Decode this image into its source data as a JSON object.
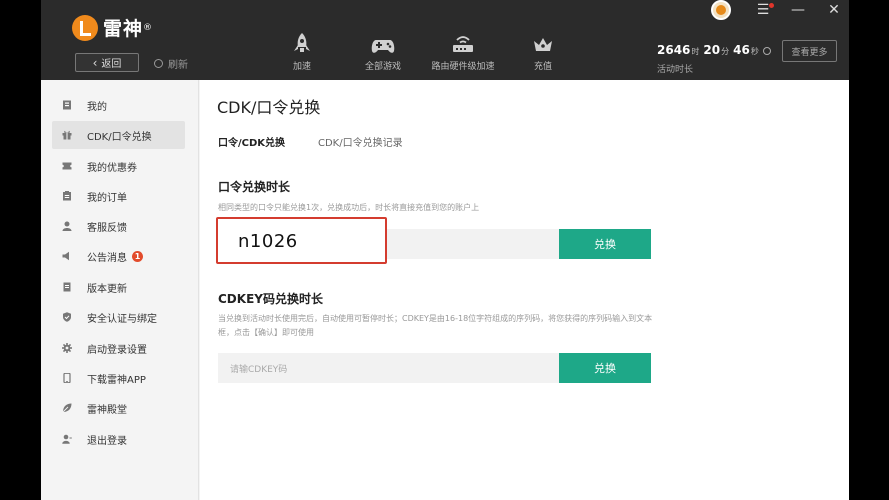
{
  "app": {
    "name": "雷神",
    "trademark": "®"
  },
  "topbar": {
    "back_label": "返回",
    "refresh_label": "刷新",
    "nav": [
      {
        "label": "加速",
        "icon": "rocket-icon"
      },
      {
        "label": "全部游戏",
        "icon": "gamepad-icon"
      },
      {
        "label": "路由硬件级加速",
        "icon": "router-icon"
      },
      {
        "label": "充值",
        "icon": "crown-icon"
      }
    ],
    "time": {
      "hours": "2646",
      "hours_unit": "时",
      "minutes": "20",
      "minutes_unit": "分",
      "seconds": "46",
      "seconds_unit": "秒",
      "label": "活动时长"
    },
    "view_more": "查看更多",
    "controls": {
      "menu": "☰",
      "minimize": "—",
      "close": "✕"
    }
  },
  "sidebar": {
    "items": [
      {
        "label": "我的",
        "icon": "user-card-icon"
      },
      {
        "label": "CDK/口令兑换",
        "icon": "gift-icon",
        "active": true
      },
      {
        "label": "我的优惠券",
        "icon": "coupon-icon"
      },
      {
        "label": "我的订单",
        "icon": "order-icon"
      },
      {
        "label": "客服反馈",
        "icon": "support-icon"
      },
      {
        "label": "公告消息",
        "icon": "speaker-icon",
        "badge": "1"
      },
      {
        "label": "版本更新",
        "icon": "update-icon"
      },
      {
        "label": "安全认证与绑定",
        "icon": "shield-icon"
      },
      {
        "label": "启动登录设置",
        "icon": "gear-icon"
      },
      {
        "label": "下载雷神APP",
        "icon": "phone-icon"
      },
      {
        "label": "雷神殿堂",
        "icon": "leaf-icon"
      },
      {
        "label": "退出登录",
        "icon": "logout-user-icon"
      }
    ]
  },
  "main": {
    "title": "CDK/口令兑换",
    "tabs": [
      {
        "label": "口令/CDK兑换",
        "active": true
      },
      {
        "label": "CDK/口令兑换记录",
        "active": false
      }
    ],
    "password_section": {
      "title": "口令兑换时长",
      "desc": "相同类型的口令只能兑换1次，兑换成功后，时长将直接充值到您的账户上",
      "input_value": "",
      "button": "兑换",
      "overlay_code": "n1026"
    },
    "cdkey_section": {
      "title": "CDKEY码兑换时长",
      "desc": "当兑换到活动时长使用完后，自动使用可暂停时长；CDKEY是由16-18位字符组成的序列码，将您获得的序列码输入到文本框，点击【确认】即可使用",
      "placeholder": "请输CDKEY码",
      "button": "兑换"
    }
  },
  "colors": {
    "accent_green": "#1ea888",
    "logo_orange": "#f08a1c",
    "highlight_red": "#d43c2f",
    "badge_red": "#e24b2b",
    "topbar_bg": "#2b2b2b"
  }
}
